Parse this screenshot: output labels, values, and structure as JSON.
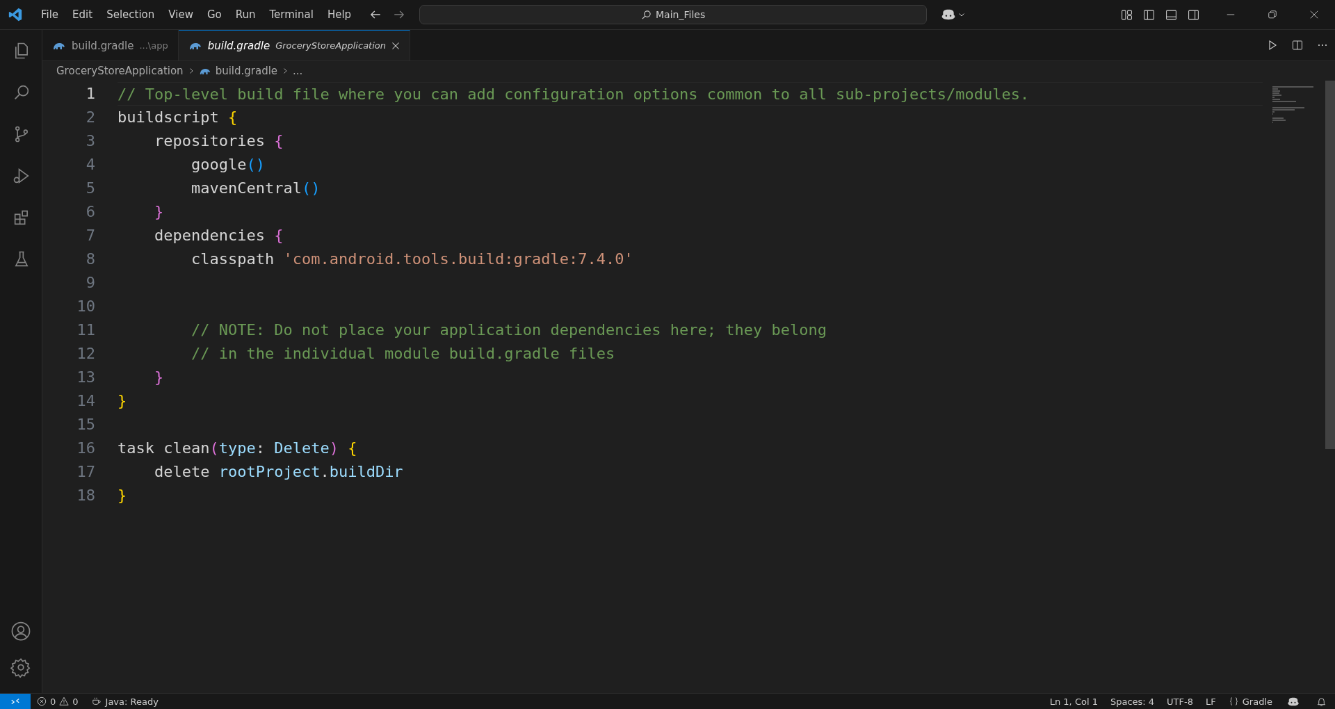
{
  "menu": [
    "File",
    "Edit",
    "Selection",
    "View",
    "Go",
    "Run",
    "Terminal",
    "Help"
  ],
  "search": {
    "value": "Main_Files"
  },
  "activity_bar": [
    {
      "kind": "explorer",
      "selected": false
    },
    {
      "kind": "search",
      "selected": false
    },
    {
      "kind": "source-control",
      "selected": false
    },
    {
      "kind": "run-debug",
      "selected": false
    },
    {
      "kind": "extensions",
      "selected": false
    },
    {
      "kind": "testing",
      "selected": false
    }
  ],
  "tabs": [
    {
      "label": "build.gradle",
      "description": "...\\app",
      "selected": false
    },
    {
      "label": "build.gradle",
      "description": "GroceryStoreApplication",
      "selected": true
    }
  ],
  "breadcrumbs": [
    "GroceryStoreApplication",
    "build.gradle",
    "..."
  ],
  "editor": {
    "lines": [
      {
        "number": "1",
        "current": true,
        "tokens": [
          {
            "t": "// Top-level build file where you can add configuration options common to all sub-projects/modules.",
            "kind": "comment"
          }
        ]
      },
      {
        "number": "2",
        "current": false,
        "tokens": [
          {
            "t": "buildscript ",
            "kind": "plain"
          },
          {
            "t": "{",
            "kind": "bracket1"
          }
        ]
      },
      {
        "number": "3",
        "current": false,
        "tokens": [
          {
            "t": "    repositories ",
            "kind": "plain"
          },
          {
            "t": "{",
            "kind": "bracket2"
          }
        ]
      },
      {
        "number": "4",
        "current": false,
        "tokens": [
          {
            "t": "        google",
            "kind": "plain"
          },
          {
            "t": "()",
            "kind": "bracket3"
          }
        ]
      },
      {
        "number": "5",
        "current": false,
        "tokens": [
          {
            "t": "        mavenCentral",
            "kind": "plain"
          },
          {
            "t": "()",
            "kind": "bracket3"
          }
        ]
      },
      {
        "number": "6",
        "current": false,
        "tokens": [
          {
            "t": "    }",
            "kind": "bracket2"
          }
        ]
      },
      {
        "number": "7",
        "current": false,
        "tokens": [
          {
            "t": "    dependencies ",
            "kind": "plain"
          },
          {
            "t": "{",
            "kind": "bracket2"
          }
        ]
      },
      {
        "number": "8",
        "current": false,
        "tokens": [
          {
            "t": "        classpath ",
            "kind": "plain"
          },
          {
            "t": "'com.android.tools.build:gradle:7.4.0'",
            "kind": "string"
          }
        ]
      },
      {
        "number": "9",
        "current": false
      },
      {
        "number": "10",
        "current": false
      },
      {
        "number": "11",
        "current": false,
        "tokens": [
          {
            "t": "        // NOTE: Do not place your application dependencies here; they belong",
            "kind": "comment"
          }
        ]
      },
      {
        "number": "12",
        "current": false,
        "tokens": [
          {
            "t": "        // in the individual module build.gradle files",
            "kind": "comment"
          }
        ]
      },
      {
        "number": "13",
        "current": false,
        "tokens": [
          {
            "t": "    }",
            "kind": "bracket2"
          }
        ]
      },
      {
        "number": "14",
        "current": false,
        "tokens": [
          {
            "t": "}",
            "kind": "bracket1"
          }
        ]
      },
      {
        "number": "15",
        "current": false
      },
      {
        "number": "16",
        "current": false,
        "tokens": [
          {
            "t": "task clean",
            "kind": "plain"
          },
          {
            "t": "(",
            "kind": "bracket2"
          },
          {
            "t": "type",
            "kind": "property"
          },
          {
            "t": ": ",
            "kind": "plain"
          },
          {
            "t": "Delete",
            "kind": "property"
          },
          {
            "t": ")",
            "kind": "bracket2"
          },
          {
            "t": " {",
            "kind": "bracket1"
          }
        ]
      },
      {
        "number": "17",
        "current": false,
        "tokens": [
          {
            "t": "    delete ",
            "kind": "plain"
          },
          {
            "t": "rootProject",
            "kind": "property"
          },
          {
            "t": ".",
            "kind": "plain"
          },
          {
            "t": "buildDir",
            "kind": "property"
          }
        ]
      },
      {
        "number": "18",
        "current": false,
        "tokens": [
          {
            "t": "}",
            "kind": "bracket1"
          }
        ]
      }
    ]
  },
  "status_bar": {
    "errors": "0",
    "warnings": "0",
    "java": "Java: Ready",
    "position": "Ln 1, Col 1",
    "spaces": "Spaces: 4",
    "encoding": "UTF-8",
    "eol": "LF",
    "language": "Gradle"
  }
}
